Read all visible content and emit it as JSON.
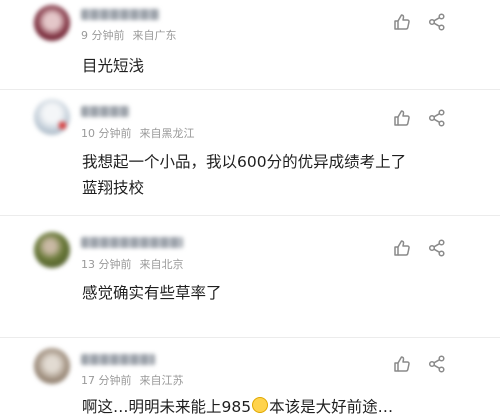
{
  "colors": {
    "meta_text": "#9a9a9a",
    "body_text": "#1f1f1f",
    "icon": "#8a8a8a",
    "divider": "#ececec"
  },
  "comments": [
    {
      "time": "9 分钟前",
      "location": "来自广东",
      "text": "目光短浅",
      "avatar_colors": [
        "#7a2a3a",
        "#e4c7c9"
      ],
      "like_icon": "thumbs-up-icon",
      "share_icon": "share-icon"
    },
    {
      "time": "10 分钟前",
      "location": "来自黑龙江",
      "text_lines": [
        "我想起一个小品，我以600分的优异成绩考上了",
        "蓝翔技校"
      ],
      "avatar_colors": [
        "#b9c6d2",
        "#e8eef3"
      ],
      "like_icon": "thumbs-up-icon",
      "share_icon": "share-icon"
    },
    {
      "time": "13 分钟前",
      "location": "来自北京",
      "text": "感觉确实有些草率了",
      "avatar_colors": [
        "#4f5a2b",
        "#c9b9a4"
      ],
      "like_icon": "thumbs-up-icon",
      "share_icon": "share-icon"
    },
    {
      "time": "17 分钟前",
      "location": "来自江苏",
      "text_before_emoji": "啊这…明明未来能上985",
      "emoji": "yawning-face-emoji",
      "text_after_emoji": "本该是大好前途…",
      "avatar_colors": [
        "#9c8b7a",
        "#d8d0c6"
      ],
      "like_icon": "thumbs-up-icon",
      "share_icon": "share-icon"
    }
  ]
}
